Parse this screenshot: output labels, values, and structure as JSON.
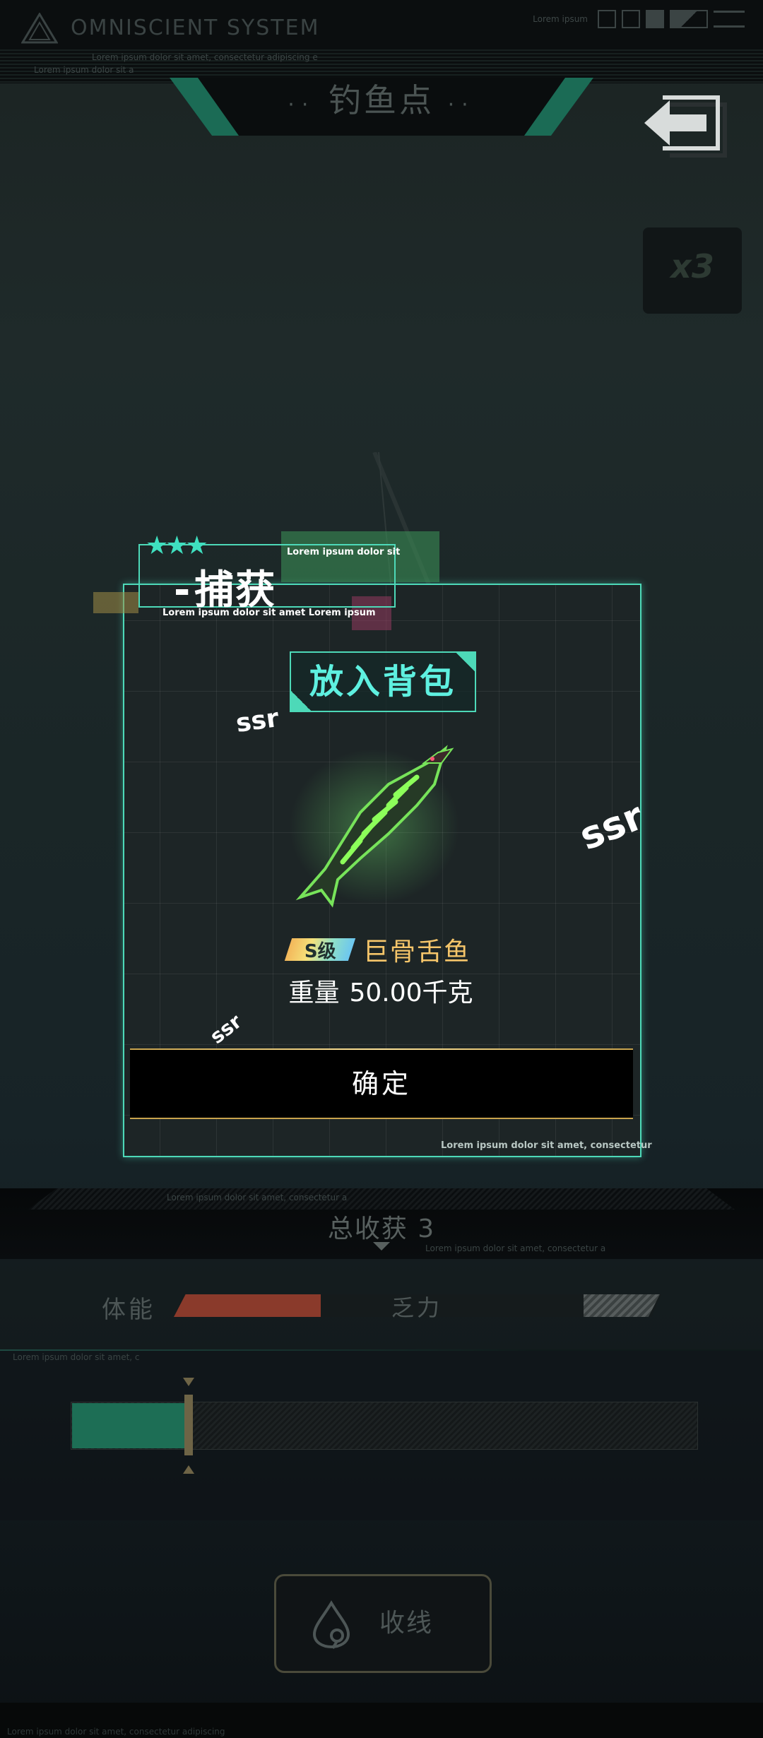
{
  "header": {
    "system_title": "OMNISCIENT SYSTEM",
    "system_sub1": "Lorem ipsum dolor sit amet, consectetur adipiscing e",
    "system_sub2": "Lorem ipsum dolor sit a",
    "status_text": "Lorem ipsum"
  },
  "spot_title": "钓鱼点",
  "multiplier": "x3",
  "capture": {
    "title": "捕获",
    "note_top": "Lorem ipsum dolor sit",
    "note_bottom": "Lorem ipsum dolor sit amet Lorem ipsum",
    "stars": "★★★",
    "bag_button": "放入背包",
    "ssr_labels": [
      "ssr",
      "ssr",
      "ssr"
    ],
    "grade": "S级",
    "fish_name": "巨骨舌鱼",
    "weight_label": "重量",
    "weight_value": "50.00千克",
    "confirm": "确定",
    "footer": "Lorem ipsum dolor sit amet, consectetur"
  },
  "harvest": {
    "note1": "Lorem ipsum dolor sit amet, consectetur a",
    "note2": "Lorem ipsum dolor sit amet, consectetur a",
    "label": "总收获 3"
  },
  "stamina": {
    "label": "体能",
    "state": "乏力",
    "level": 0.2
  },
  "tension": {
    "note": "Lorem ipsum dolor sit amet, c",
    "level": 0.18
  },
  "reel_button": "收线",
  "footer_note": "Lorem ipsum dolor sit amet, consectetur adipiscing",
  "colors": {
    "accent": "#4dd9b8",
    "gold": "#c8a34d",
    "fish_name": "#f5c56a",
    "stamina": "#8a3a2b",
    "tension": "#1d6e55"
  }
}
